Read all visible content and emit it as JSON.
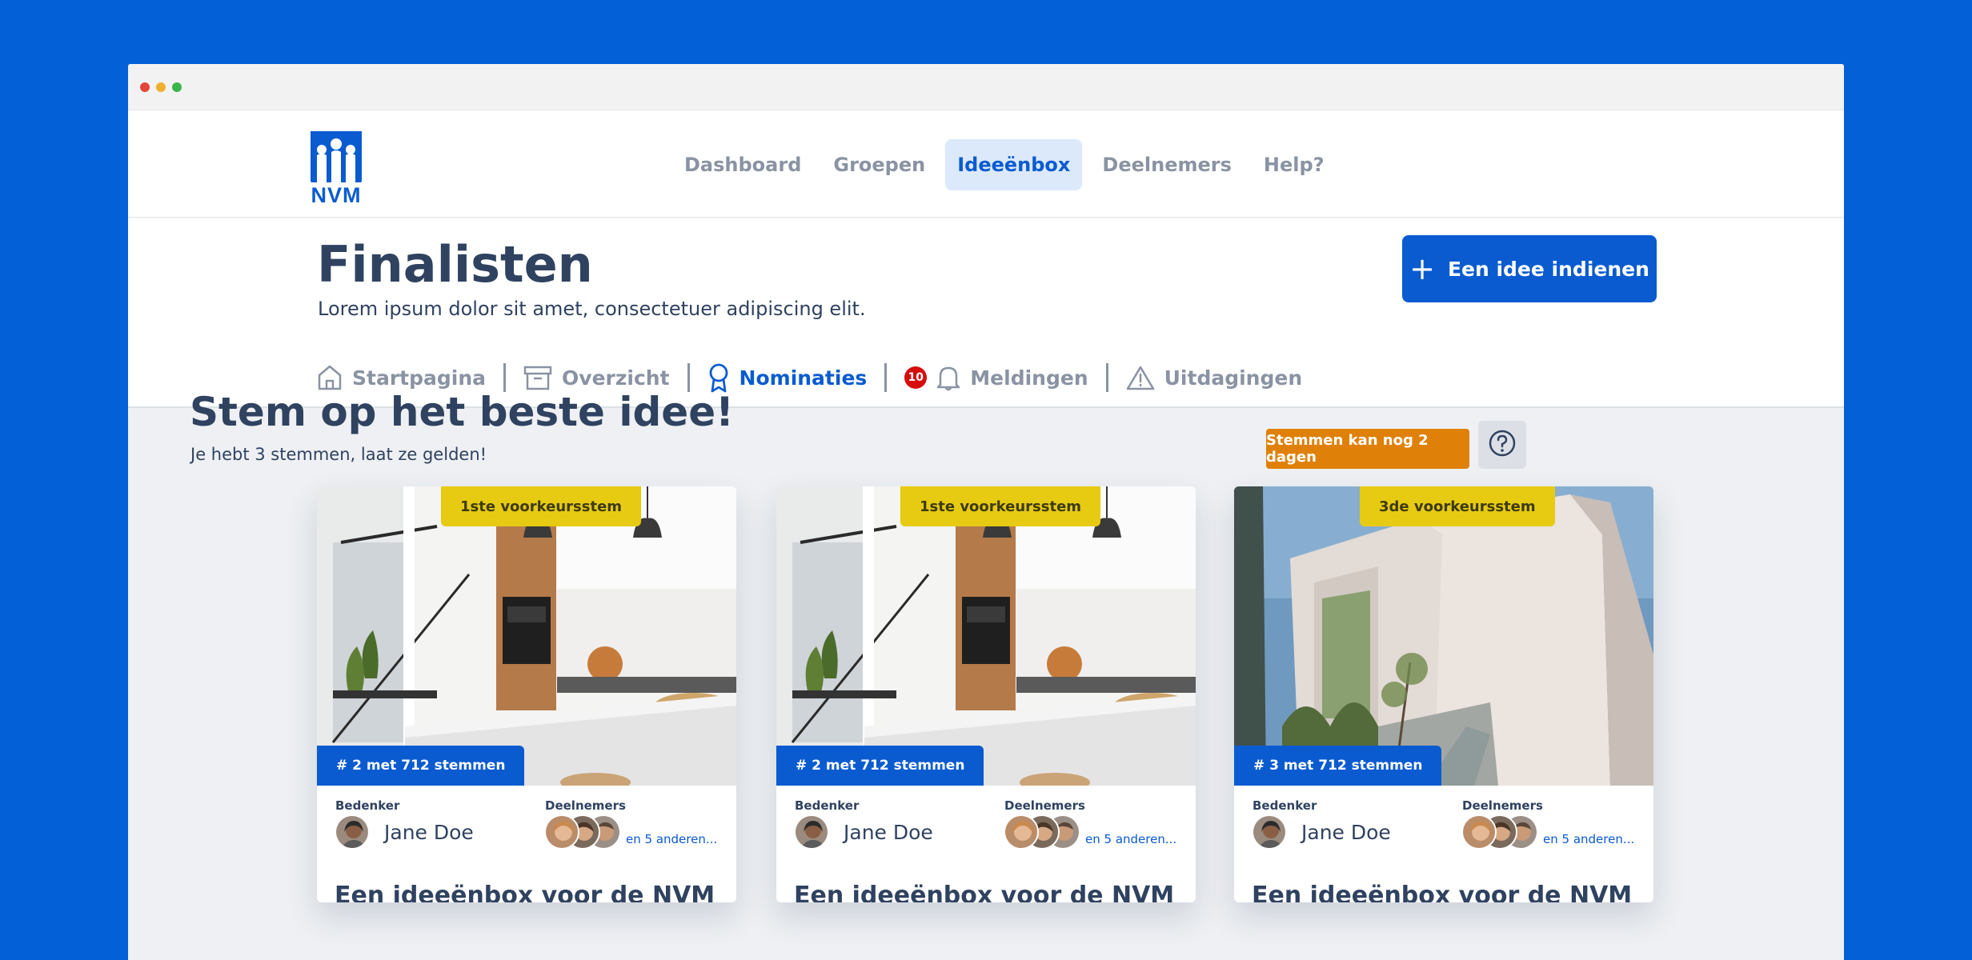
{
  "nav": {
    "logo_text": "NVM",
    "items": [
      {
        "label": "Dashboard"
      },
      {
        "label": "Groepen"
      },
      {
        "label": "Ideeënbox"
      },
      {
        "label": "Deelnemers"
      },
      {
        "label": "Help?"
      }
    ]
  },
  "header": {
    "title": "Finalisten",
    "subtitle": "Lorem ipsum dolor sit amet, consectetuer adipiscing elit.",
    "primary_button": "Een idee indienen"
  },
  "tabs": [
    {
      "label": "Startpagina",
      "icon": "home-icon"
    },
    {
      "label": "Overzicht",
      "icon": "archive-icon"
    },
    {
      "label": "Nominaties",
      "icon": "award-icon"
    },
    {
      "label": "Meldingen",
      "icon": "bell-icon",
      "badge": "10"
    },
    {
      "label": "Uitdagingen",
      "icon": "warning-icon"
    }
  ],
  "section": {
    "title": "Stem op het beste idee!",
    "subtitle": "Je hebt 3 stemmen, laat ze gelden!",
    "deadline": "Stemmen kan nog 2 dagen"
  },
  "cards": [
    {
      "rank": "1ste voorkeursstem",
      "votes": "# 2 met 712 stemmen",
      "author_label": "Bedenker",
      "author": "Jane Doe",
      "participants_label": "Deelnemers",
      "others": "en 5 anderen...",
      "title": "Een ideeënbox voor de NVM",
      "image": "kitchen"
    },
    {
      "rank": "1ste voorkeursstem",
      "votes": "# 2 met 712 stemmen",
      "author_label": "Bedenker",
      "author": "Jane Doe",
      "participants_label": "Deelnemers",
      "others": "en 5 anderen...",
      "title": "Een ideeënbox voor de NVM",
      "image": "kitchen"
    },
    {
      "rank": "3de voorkeursstem",
      "votes": "# 3 met 712 stemmen",
      "author_label": "Bedenker",
      "author": "Jane Doe",
      "participants_label": "Deelnemers",
      "others": "en 5 anderen...",
      "title": "Een ideeënbox voor de NVM",
      "image": "building"
    }
  ],
  "colors": {
    "brand": "#0a5bd0",
    "background": "#0460d6",
    "rank_tag": "#e6cb12",
    "deadline": "#df8108",
    "badge": "#d60d0d"
  }
}
